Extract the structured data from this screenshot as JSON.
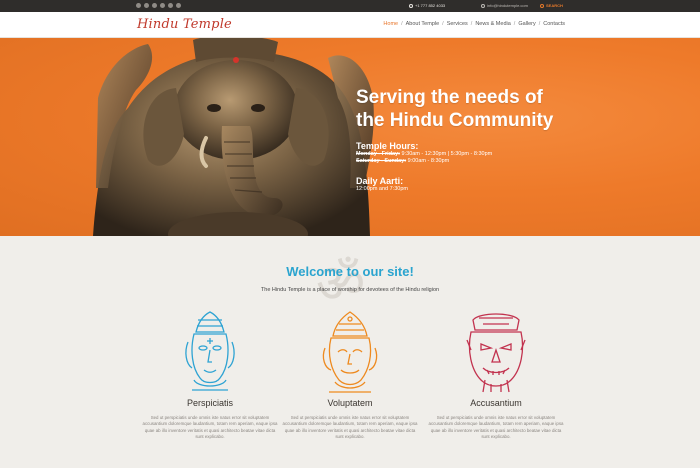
{
  "topbar": {
    "phone": "+1 777 852 4033",
    "email": "info@hindutemple.com",
    "search_label": "SEARCH",
    "social_icons": [
      "social-icon",
      "twitter-icon",
      "facebook-icon",
      "pinterest-icon",
      "googleplus-icon",
      "rss-icon"
    ]
  },
  "header": {
    "logo": "Hindu Temple",
    "nav": [
      "Home",
      "About Temple",
      "Services",
      "News & Media",
      "Gallery",
      "Contacts"
    ],
    "active_nav": "Home"
  },
  "hero": {
    "title_line1": "Serving the needs of",
    "title_line2": "the Hindu Community",
    "hours_title": "Temple Hours:",
    "weekday_label": "Monday - Friday:",
    "weekday_hours": " 9:30am - 12:30pm | 5:30pm - 8:30pm",
    "weekend_label": "Saturday - Sunday:",
    "weekend_hours": " 9:00am - 8:30pm",
    "aarti_title": "Daily Aarti:",
    "aarti_times": "12:00pm and 7:30pm"
  },
  "welcome": {
    "title": "Welcome to our site!",
    "subtitle": "The Hindu Temple is a place of worship for devotees of the Hindu religion",
    "features": [
      {
        "title": "Perspiciatis",
        "text": "Sed ut perspiciatis unde omnis iste natus error sit voluptatem accusantium doloremque laudantium, totam rem aperiam, eaque ipsa quae ab illo inventore veritatis et quasi architecto beatae vitae dicta sunt explicabo.",
        "color": "#2ea3d3"
      },
      {
        "title": "Voluptatem",
        "text": "Sed ut perspiciatis unde omnis iste natus error sit voluptatem accusantium doloremque laudantium, totam rem aperiam, eaque ipsa quae ab illo inventore veritatis et quasi architecto beatae vitae dicta sunt explicabo.",
        "color": "#ee8a1f"
      },
      {
        "title": "Accusantium",
        "text": "Sed ut perspiciatis unde omnis iste natus error sit voluptatem accusantium doloremque laudantium, totam rem aperiam, eaque ipsa quae ab illo inventore veritatis et quasi architecto beatae vitae dicta sunt explicabo.",
        "color": "#c2334f"
      }
    ]
  },
  "colors": {
    "accent": "#e8762b",
    "hero_bg": "#ef7b2c",
    "title_blue": "#2aa4cf"
  }
}
